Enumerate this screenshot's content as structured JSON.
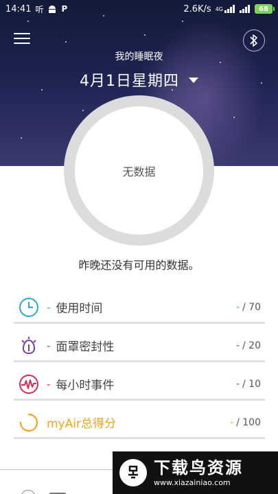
{
  "status_bar": {
    "time": "14:41",
    "left_icons": [
      "听",
      "android-icon",
      "P"
    ],
    "network_speed": "2.6K/s",
    "network_type": "4G",
    "battery": "68"
  },
  "header": {
    "title": "我的睡眠夜",
    "date": "4月1日星期四"
  },
  "ring": {
    "center_text": "无数据"
  },
  "message": "昨晚还没有可用的数据。",
  "metrics": [
    {
      "label": "使用时间",
      "dash": "-",
      "value": "-",
      "max": "/ 70",
      "color": "#2aa7c9",
      "icon": "clock-icon"
    },
    {
      "label": "面罩密封性",
      "dash": "-",
      "value": "-",
      "max": "/ 20",
      "color": "#7b3fa0",
      "icon": "mask-icon"
    },
    {
      "label": "每小时事件",
      "dash": "-",
      "value": "-",
      "max": "/ 10",
      "color": "#d62b5a",
      "icon": "events-icon"
    },
    {
      "label": "myAir总得分",
      "dash": "",
      "value": "-",
      "max": "/ 100",
      "color": "#f2a31b",
      "icon": "score-icon"
    }
  ],
  "watermark": {
    "title": "下载鸟资源",
    "url": "www.xiazainiao.com"
  }
}
